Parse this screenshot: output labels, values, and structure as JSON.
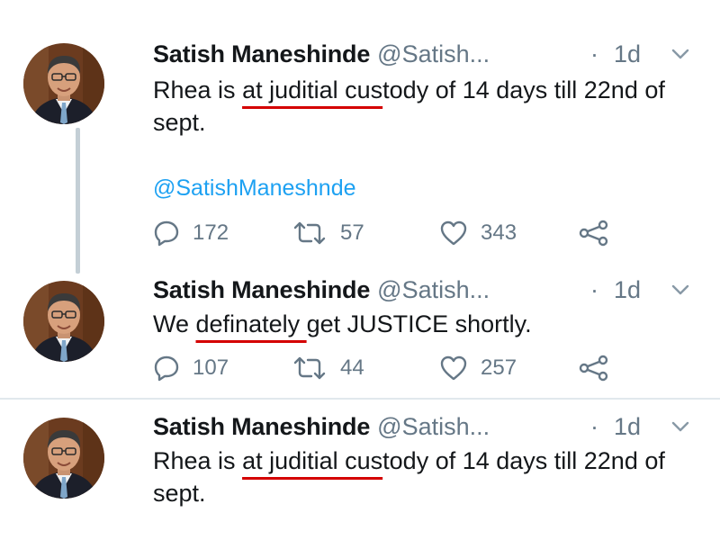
{
  "tweets": [
    {
      "author_name": "Satish Maneshinde",
      "author_handle": "@Satish...",
      "separator": "·",
      "time": "1d",
      "text_before": "Rhea is ",
      "text_underlined": "at juditial cus",
      "text_after": "tody of 14 days till 22nd of sept.",
      "mention": "@SatishManeshnde",
      "reply_count": "172",
      "retweet_count": "57",
      "like_count": "343"
    },
    {
      "author_name": "Satish Maneshinde",
      "author_handle": "@Satish...",
      "separator": "·",
      "time": "1d",
      "text_before": "We ",
      "text_underlined": "definately ",
      "text_after": "get JUSTICE shortly.",
      "reply_count": "107",
      "retweet_count": "44",
      "like_count": "257"
    },
    {
      "author_name": "Satish Maneshinde",
      "author_handle": "@Satish...",
      "separator": "·",
      "time": "1d",
      "text_before": "Rhea is ",
      "text_underlined": "at juditial cus",
      "text_after": "tody of 14 days till 22nd of sept."
    }
  ],
  "icons": {
    "reply": "speech-bubble-icon",
    "retweet": "retweet-arrows-icon",
    "like": "heart-icon",
    "share": "share-nodes-icon",
    "more": "chevron-down-icon"
  },
  "colors": {
    "text": "#14171a",
    "muted": "#657786",
    "link": "#1da1f2",
    "underline": "#d40000",
    "thread_line": "#c4cfd6"
  }
}
